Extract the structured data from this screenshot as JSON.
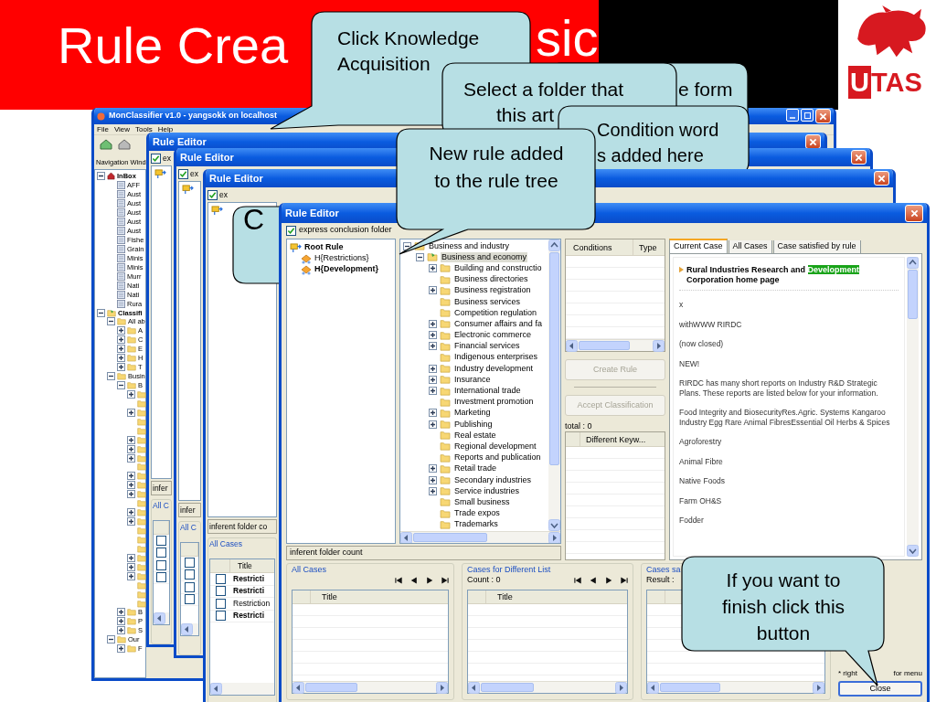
{
  "slide": {
    "title_parts": [
      "Rule Crea",
      "sic"
    ],
    "logo": "UTAS"
  },
  "app_window": {
    "title": "MonClassifier v1.0 - yangsokk on localhost",
    "menu": [
      "File",
      "View",
      "Tools",
      "Help"
    ],
    "nav_label": "Navigation Wind",
    "tree": [
      {
        "label": "InBox",
        "kind": "inbox",
        "expanded": true,
        "expandable": true,
        "children": [
          {
            "label": "AFF",
            "kind": "feed"
          },
          {
            "label": "Aust",
            "kind": "feed"
          },
          {
            "label": "Aust",
            "kind": "feed"
          },
          {
            "label": "Aust",
            "kind": "feed"
          },
          {
            "label": "Aust",
            "kind": "feed"
          },
          {
            "label": "Aust",
            "kind": "feed"
          },
          {
            "label": "Fishe",
            "kind": "feed"
          },
          {
            "label": "Grain",
            "kind": "feed"
          },
          {
            "label": "Minis",
            "kind": "feed"
          },
          {
            "label": "Minis",
            "kind": "feed"
          },
          {
            "label": "Murr",
            "kind": "feed"
          },
          {
            "label": "Nati",
            "kind": "feed"
          },
          {
            "label": "Nati",
            "kind": "feed"
          },
          {
            "label": "Rura",
            "kind": "feed"
          }
        ]
      },
      {
        "label": "Classifi",
        "kind": "classifier",
        "expanded": true,
        "expandable": true,
        "children": [
          {
            "label": "All ab",
            "kind": "folder",
            "expanded": true,
            "expandable": true,
            "children": [
              {
                "label": "A",
                "kind": "folder",
                "expandable": true
              },
              {
                "label": "C",
                "kind": "folder",
                "expandable": true
              },
              {
                "label": "E",
                "kind": "folder",
                "expandable": true
              },
              {
                "label": "H",
                "kind": "folder",
                "expandable": true
              },
              {
                "label": "T",
                "kind": "folder",
                "expandable": true
              }
            ]
          },
          {
            "label": "Busin",
            "kind": "folder",
            "expanded": true,
            "expandable": true,
            "children": [
              {
                "label": "B",
                "kind": "folder",
                "expanded": true,
                "expandable": true,
                "children": [
                  {
                    "kind": "folder",
                    "expandable": true
                  },
                  {
                    "kind": "folder",
                    "expandable": false
                  },
                  {
                    "kind": "folder",
                    "expandable": true
                  },
                  {
                    "kind": "folder",
                    "expandable": false
                  },
                  {
                    "kind": "folder",
                    "expandable": false
                  },
                  {
                    "kind": "folder",
                    "expandable": true
                  },
                  {
                    "kind": "folder",
                    "expandable": true
                  },
                  {
                    "kind": "folder",
                    "expandable": true
                  },
                  {
                    "kind": "folder",
                    "expandable": false
                  },
                  {
                    "kind": "folder",
                    "expandable": true
                  },
                  {
                    "kind": "folder",
                    "expandable": true
                  },
                  {
                    "kind": "folder",
                    "expandable": true
                  },
                  {
                    "kind": "folder",
                    "expandable": false
                  },
                  {
                    "kind": "folder",
                    "expandable": true
                  },
                  {
                    "kind": "folder",
                    "expandable": true
                  },
                  {
                    "kind": "folder",
                    "expandable": false
                  },
                  {
                    "kind": "folder",
                    "expandable": false
                  },
                  {
                    "kind": "folder",
                    "expandable": false
                  },
                  {
                    "kind": "folder",
                    "expandable": true
                  },
                  {
                    "kind": "folder",
                    "expandable": true
                  },
                  {
                    "kind": "folder",
                    "expandable": true
                  },
                  {
                    "kind": "folder",
                    "expandable": false
                  },
                  {
                    "kind": "folder",
                    "expandable": false
                  },
                  {
                    "kind": "folder",
                    "expandable": false
                  }
                ]
              },
              {
                "label": "B",
                "kind": "folder",
                "expandable": true
              },
              {
                "label": "P",
                "kind": "folder",
                "expandable": true
              },
              {
                "label": "S",
                "kind": "folder",
                "expandable": true
              }
            ]
          },
          {
            "label": "Our",
            "kind": "folder",
            "expanded": true,
            "expandable": true,
            "children": [
              {
                "label": "F",
                "kind": "folder",
                "expandable": true
              }
            ]
          }
        ]
      }
    ]
  },
  "background_editors": [
    {
      "title": "Rule Editor",
      "checkbox": {
        "label": "ex",
        "checked": true
      },
      "field": "infer",
      "group": "All C",
      "rows": [
        {
          "checked": false
        },
        {
          "checked": false
        },
        {
          "checked": false
        },
        {
          "checked": false
        }
      ]
    },
    {
      "title": "Rule Editor",
      "checkbox": {
        "label": "ex",
        "checked": true
      },
      "field": "infer",
      "group": "All C",
      "rows": [
        {
          "checked": false
        },
        {
          "checked": false
        },
        {
          "checked": false
        },
        {
          "checked": false
        }
      ]
    },
    {
      "title": "Rule Editor",
      "checkbox": {
        "label": "ex",
        "checked": true
      },
      "field": "inferent folder co",
      "group": "All Cases",
      "column": "Title",
      "rows": [
        {
          "title": "Restricti",
          "checked": false,
          "bold": true
        },
        {
          "title": "Restricti",
          "checked": false,
          "bold": true
        },
        {
          "title": "Restriction",
          "checked": false,
          "bold": false
        },
        {
          "title": "Restricti",
          "checked": false,
          "bold": true
        }
      ]
    }
  ],
  "rule_editor": {
    "title": "Rule Editor",
    "conclusion_checkbox": {
      "label": "express conclusion folder",
      "checked": true
    },
    "rule_tree": {
      "label": "Root Rule",
      "children": [
        {
          "label": "H{Restrictions}",
          "bold": false
        },
        {
          "label": "H{Development}",
          "bold": true
        }
      ]
    },
    "folder_tree": {
      "label": "Business and industry",
      "expanded": true,
      "expandable": true,
      "selected": false,
      "children": [
        {
          "label": "Business and economy",
          "expanded": true,
          "expandable": true,
          "selected": true,
          "children": [
            {
              "label": "Building and constructio",
              "expandable": true,
              "selected": false
            },
            {
              "label": "Business directories",
              "expandable": false,
              "selected": false
            },
            {
              "label": "Business registration",
              "expandable": true,
              "selected": false
            },
            {
              "label": "Business services",
              "expandable": false,
              "selected": false
            },
            {
              "label": "Competition regulation",
              "expandable": false,
              "selected": false
            },
            {
              "label": "Consumer affairs and fa",
              "expandable": true,
              "selected": false
            },
            {
              "label": "Electronic commerce",
              "expandable": true,
              "selected": false
            },
            {
              "label": "Financial services",
              "expandable": true,
              "selected": false
            },
            {
              "label": "Indigenous enterprises",
              "expandable": false,
              "selected": false
            },
            {
              "label": "Industry development",
              "expandable": true,
              "selected": false
            },
            {
              "label": "Insurance",
              "expandable": true,
              "selected": false
            },
            {
              "label": "International trade",
              "expandable": true,
              "selected": false
            },
            {
              "label": "Investment promotion",
              "expandable": false,
              "selected": false
            },
            {
              "label": "Marketing",
              "expandable": true,
              "selected": false
            },
            {
              "label": "Publishing",
              "expandable": true,
              "selected": false
            },
            {
              "label": "Real estate",
              "expandable": false,
              "selected": false
            },
            {
              "label": "Regional development",
              "expandable": false,
              "selected": false
            },
            {
              "label": "Reports and publication",
              "expandable": false,
              "selected": false
            },
            {
              "label": "Retail trade",
              "expandable": true,
              "selected": false
            },
            {
              "label": "Secondary industries",
              "expandable": true,
              "selected": false
            },
            {
              "label": "Service industries",
              "expandable": true,
              "selected": false
            },
            {
              "label": "Small business",
              "expandable": false,
              "selected": false
            },
            {
              "label": "Trade expos",
              "expandable": false,
              "selected": false
            },
            {
              "label": "Trademarks",
              "expandable": false,
              "selected": false
            }
          ]
        }
      ]
    },
    "count_field": "inferent folder count",
    "conditions_table": {
      "columns": [
        "Conditions",
        "Type"
      ]
    },
    "buttons": [
      {
        "label": "Create Rule",
        "disabled": true
      },
      {
        "label": "Accept Classification",
        "disabled": true
      }
    ],
    "total": "total : 0",
    "keyword_table": {
      "columns": [
        "Different Keyw..."
      ]
    },
    "case_tabs": [
      {
        "label": "Current Case",
        "selected": true
      },
      {
        "label": "All Cases",
        "selected": false
      },
      {
        "label": "Case satisfied by rule",
        "selected": false
      }
    ],
    "case": {
      "heading_parts": [
        {
          "text": "Rural Industries Research and ",
          "highlighted": false
        },
        {
          "text": "Development",
          "highlighted": true
        },
        {
          "text": " Corporation home page",
          "highlighted": false
        }
      ],
      "paragraphs": [
        "x",
        "withWWW RIRDC",
        "(now closed)",
        "NEW!",
        "RIRDC has many short reports on Industry R&D Strategic Plans. These reports are listed below for your information.",
        "Food Integrity and BiosecurityRes.Agric. Systems Kangaroo Industry Egg Rare Animal FibresEssential Oil Herbs & Spices",
        "Agroforestry",
        "Animal Fibre",
        "Native Foods",
        "Farm OH&S",
        "Fodder"
      ]
    },
    "case_groups": [
      {
        "title": "All Cases",
        "nav": true,
        "column": "Title"
      },
      {
        "title": "Cases for Different List",
        "count": "Count : 0",
        "nav": true,
        "column": "Title"
      },
      {
        "title": "Cases sa",
        "count": "Result :"
      }
    ],
    "hint_parts": [
      "* right",
      "for menu"
    ],
    "close_button": "Close"
  },
  "callouts": [
    {
      "lines": [
        "Click Knowledge",
        "Acquisition"
      ]
    },
    {
      "lines": [
        "e form"
      ]
    },
    {
      "lines": [
        "Select a folder that",
        "this art"
      ]
    },
    {
      "lines": [
        "Condition word",
        "s added here"
      ]
    },
    {
      "lines": [
        "New rule added",
        "to the rule tree"
      ]
    },
    {
      "lines": [
        "C"
      ]
    },
    {
      "lines": [
        "If you want to",
        "finish click this",
        "button"
      ]
    }
  ]
}
